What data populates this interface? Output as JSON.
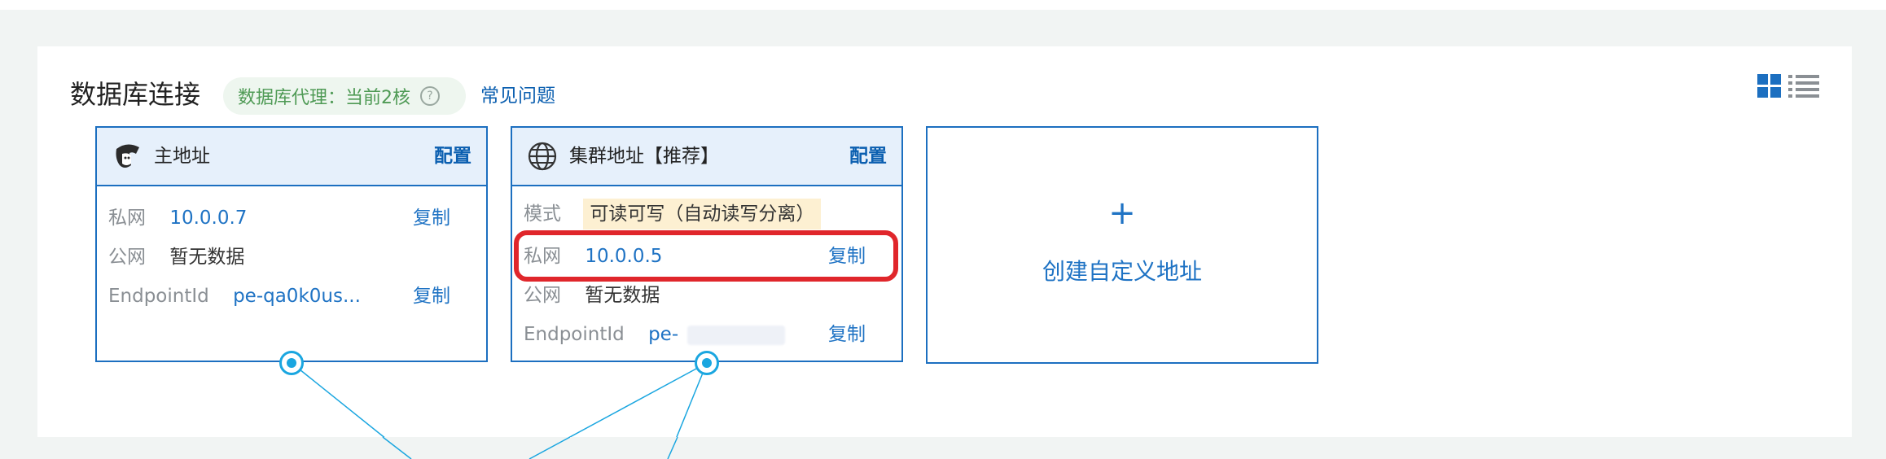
{
  "header": {
    "title": "数据库连接",
    "proxy_badge": "数据库代理：当前2核",
    "help_icon": "question-circle-icon",
    "faq_link": "常见问题",
    "view_icons": [
      "grid-view-icon",
      "list-view-icon"
    ]
  },
  "cards": [
    {
      "title": "主地址",
      "icon": "avatar-icon",
      "config": "配置",
      "rows": [
        {
          "label": "私网",
          "value": "10.0.0.7",
          "copy": "复制"
        },
        {
          "label": "公网",
          "value": "暂无数据"
        },
        {
          "label": "EndpointId",
          "value": "pe-qa0k0us...",
          "copy": "复制"
        }
      ]
    },
    {
      "title": "集群地址【推荐】",
      "icon": "globe-icon",
      "config": "配置",
      "rows": [
        {
          "label": "模式",
          "value": "可读可写（自动读写分离）"
        },
        {
          "label": "私网",
          "value": "10.0.0.5",
          "copy": "复制"
        },
        {
          "label": "公网",
          "value": "暂无数据"
        },
        {
          "label": "EndpointId",
          "value": "pe-",
          "copy": "复制"
        }
      ]
    }
  ],
  "create_card": {
    "plus": "+",
    "label": "创建自定义地址"
  },
  "colors": {
    "accent": "#1c6fc0",
    "link": "#1f73c4",
    "highlight_border": "#e0262b",
    "badge_bg": "#eef6ef",
    "badge_text": "#4f9a55",
    "mode_bg": "#fdf0d2",
    "connector": "#1aa6e0"
  }
}
